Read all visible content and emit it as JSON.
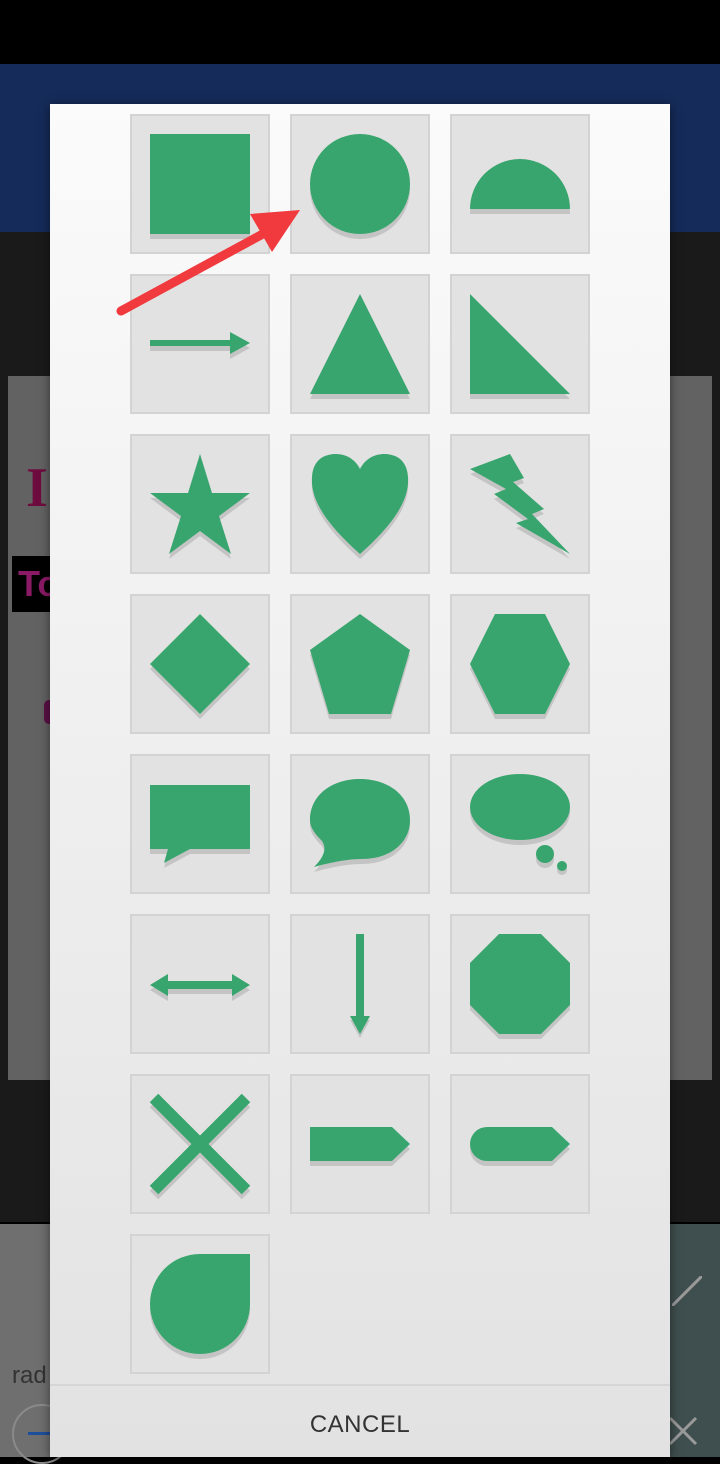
{
  "background": {
    "letter_i": "I",
    "text_to": "To",
    "bottom_label": "rad"
  },
  "dialog": {
    "cancel_label": "CANCEL",
    "shapes": [
      {
        "name": "square"
      },
      {
        "name": "circle"
      },
      {
        "name": "half-circle"
      },
      {
        "name": "arrow-right"
      },
      {
        "name": "triangle"
      },
      {
        "name": "right-triangle"
      },
      {
        "name": "star"
      },
      {
        "name": "heart"
      },
      {
        "name": "lightning"
      },
      {
        "name": "diamond"
      },
      {
        "name": "pentagon"
      },
      {
        "name": "hexagon"
      },
      {
        "name": "speech-rectangle"
      },
      {
        "name": "speech-oval"
      },
      {
        "name": "thought-bubble"
      },
      {
        "name": "double-arrow"
      },
      {
        "name": "arrow-down"
      },
      {
        "name": "octagon"
      },
      {
        "name": "cross"
      },
      {
        "name": "tag-arrow"
      },
      {
        "name": "rounded-tag"
      },
      {
        "name": "teardrop"
      }
    ]
  },
  "colors": {
    "shape_fill": "#39a56e",
    "shape_shadow": "#c2c2c2",
    "annotation_arrow": "#f03a3e"
  }
}
